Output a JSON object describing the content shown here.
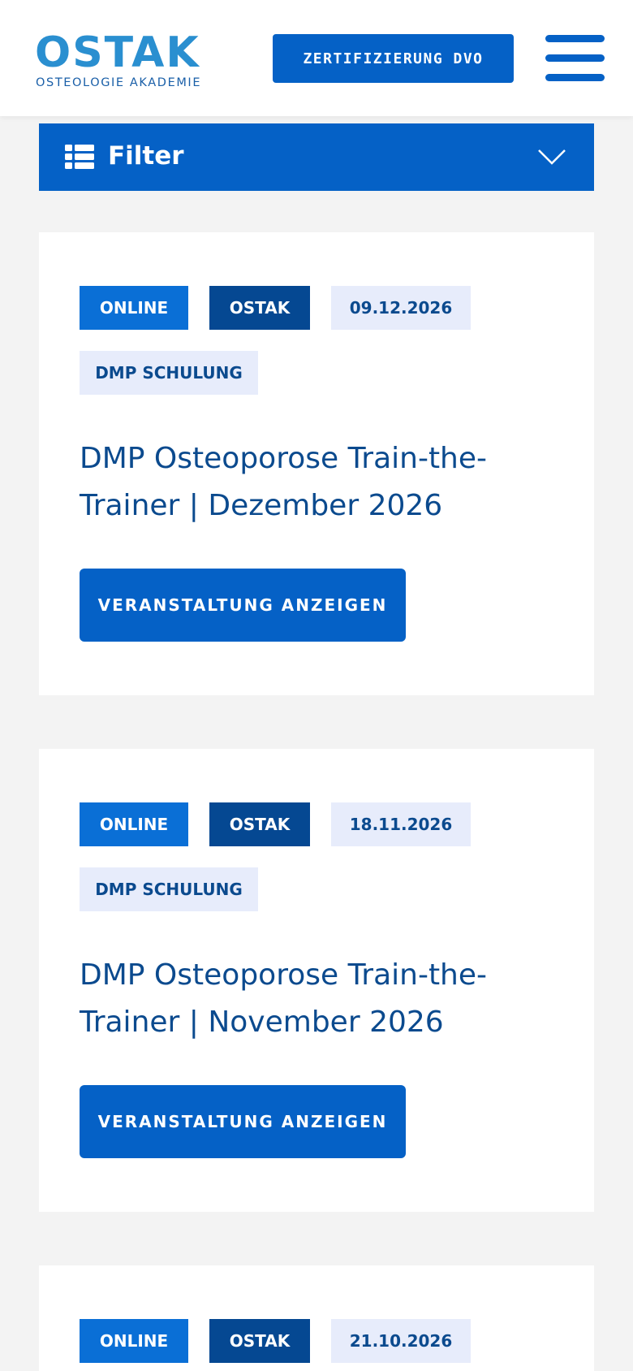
{
  "header": {
    "logo_word": "OSTAK",
    "logo_subtitle": "OSTEOLOGIE AKADEMIE",
    "cert_button": "ZERTIFIZIERUNG DVO",
    "menu_icon": "hamburger-menu-icon"
  },
  "filter": {
    "label": "Filter",
    "icon": "list-icon",
    "toggle_icon": "chevron-down-icon"
  },
  "colors": {
    "primary": "#0561c6",
    "online_tag": "#0a6fd6",
    "ostak_tag": "#054892",
    "light_tag_bg": "#e7ecfb",
    "title_text": "#0b4a8e",
    "page_bg": "#f3f3f3"
  },
  "events": [
    {
      "tags": [
        "ONLINE",
        "OSTAK",
        "09.12.2026",
        "DMP SCHULUNG"
      ],
      "title": "DMP Osteoporose Train-the-Trainer | Dezember 2026",
      "title_line1": "DMP Osteoporose Train-the-",
      "title_line2": "Trainer | Dezember 2026",
      "button": "VERANSTALTUNG ANZEIGEN"
    },
    {
      "tags": [
        "ONLINE",
        "OSTAK",
        "18.11.2026",
        "DMP SCHULUNG"
      ],
      "title": "DMP Osteoporose Train-the-Trainer | November 2026",
      "title_line1": "DMP Osteoporose Train-the-",
      "title_line2": "Trainer | November 2026",
      "button": "VERANSTALTUNG ANZEIGEN"
    },
    {
      "tags": [
        "ONLINE",
        "OSTAK",
        "21.10.2026"
      ]
    }
  ]
}
